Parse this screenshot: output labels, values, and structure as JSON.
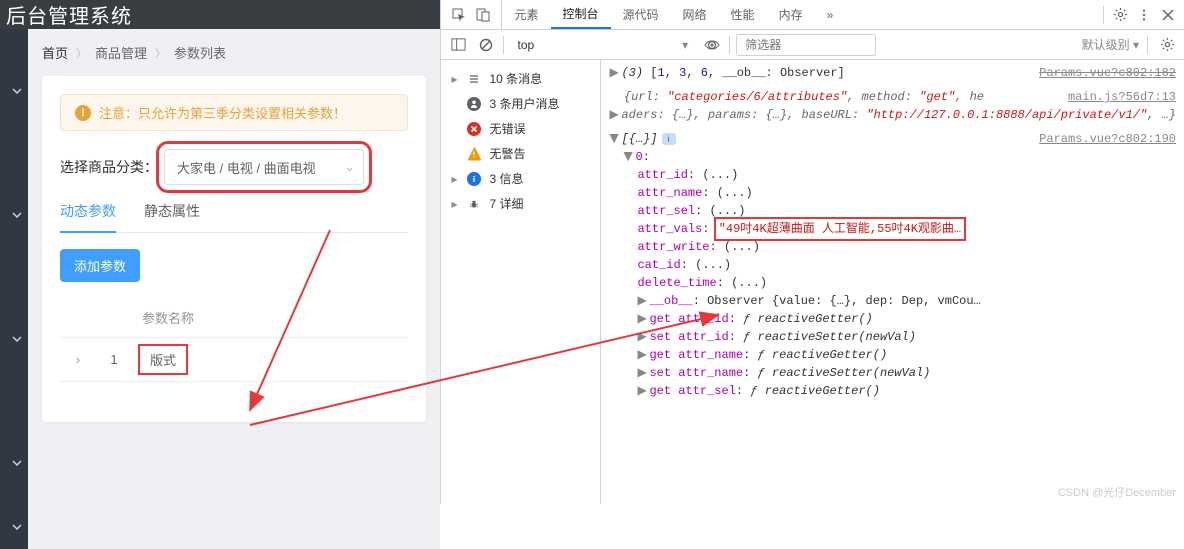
{
  "titlebar": "后台管理系统",
  "breadcrumb": {
    "home": "首页",
    "group": "商品管理",
    "page": "参数列表"
  },
  "alert": {
    "text": "注意：只允许为第三季分类设置相关参数！"
  },
  "cascader": {
    "label": "选择商品分类：",
    "value": "大家电 / 电视 / 曲面电视"
  },
  "tabs": {
    "dynamic": "动态参数",
    "static": "静态属性"
  },
  "add_btn": "添加参数",
  "table": {
    "col_name": "参数名称",
    "row_idx": "1",
    "row_value": "版式"
  },
  "devtools": {
    "tabs": {
      "elements": "元素",
      "console": "控制台",
      "sources": "源代码",
      "network": "网络",
      "performance": "性能",
      "memory": "内存"
    },
    "context": "top",
    "filter_placeholder": "筛选器",
    "level": "默认级别",
    "msgs": {
      "all": "10 条消息",
      "user": "3 条用户消息",
      "errors": "无错误",
      "warnings": "无警告",
      "info": "3 信息",
      "verbose": "7 详细"
    }
  },
  "console": {
    "src1": "Params.vue?c802:182",
    "src2": "main.js?56d7:13",
    "src3": "Params.vue?c802:190",
    "line1_a": "(3) ",
    "line1_b": "[",
    "line1_nums": [
      "1",
      "3",
      "6"
    ],
    "line1_c": "__ob__: Observer",
    "line1_d": "]",
    "line2": "{url: ",
    "line2_url": "\"categories/6/attributes\"",
    "line2_mid": ", method: ",
    "line2_method": "\"get\"",
    "line2_end": ", he",
    "line3_a": "aders: {…}, params: {…}, baseURL: ",
    "line3_b": "\"http://127.0.0.1:8888/api/private/v1/\"",
    "line3_c": ", …}",
    "arr_open": "[{…}]",
    "idx0": "0",
    "attrs": {
      "attr_id": "attr_id",
      "attr_name": "attr_name",
      "attr_sel": "attr_sel",
      "attr_vals": "attr_vals",
      "attr_write": "attr_write",
      "cat_id": "cat_id",
      "delete_time": "delete_time",
      "ellipsis": "(...)"
    },
    "attr_vals_value": "\"49吋4K超薄曲面  人工智能,55吋4K观影曲…",
    "ob_line": "__ob__",
    "ob_rest": ": Observer {value: {…}, dep: Dep, vmCou…",
    "getters": [
      {
        "kw": "get",
        "name": "attr_id",
        "fn": "reactiveGetter()"
      },
      {
        "kw": "set",
        "name": "attr_id",
        "fn": "reactiveSetter(newVal)"
      },
      {
        "kw": "get",
        "name": "attr_name",
        "fn": "reactiveGetter()"
      },
      {
        "kw": "set",
        "name": "attr_name",
        "fn": "reactiveSetter(newVal)"
      },
      {
        "kw": "get",
        "name": "attr_sel",
        "fn": "reactiveGetter()"
      }
    ]
  },
  "watermark": "CSDN @光仔December"
}
